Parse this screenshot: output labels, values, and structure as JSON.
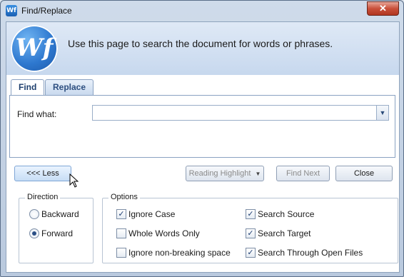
{
  "window": {
    "title": "Find/Replace",
    "close_glyph": "✕",
    "app_icon": "Wf"
  },
  "header": {
    "logo_text": "Wf",
    "description": "Use this page to search the document for words or phrases."
  },
  "tabs": [
    {
      "label": "Find",
      "active": true
    },
    {
      "label": "Replace",
      "active": false
    }
  ],
  "find": {
    "label": "Find what:",
    "value": ""
  },
  "buttons": {
    "less": "<<< Less",
    "reading_highlight": "Reading Highlight",
    "find_next": "Find Next",
    "close": "Close"
  },
  "direction": {
    "title": "Direction",
    "options": [
      {
        "label": "Backward",
        "selected": false
      },
      {
        "label": "Forward",
        "selected": true
      }
    ]
  },
  "options": {
    "title": "Options",
    "items": [
      {
        "label": "Ignore Case",
        "checked": true
      },
      {
        "label": "Whole Words Only",
        "checked": false
      },
      {
        "label": "Ignore non-breaking space",
        "checked": false
      },
      {
        "label": "Search Source",
        "checked": true
      },
      {
        "label": "Search Target",
        "checked": true
      },
      {
        "label": "Search Through Open Files",
        "checked": true
      }
    ]
  }
}
